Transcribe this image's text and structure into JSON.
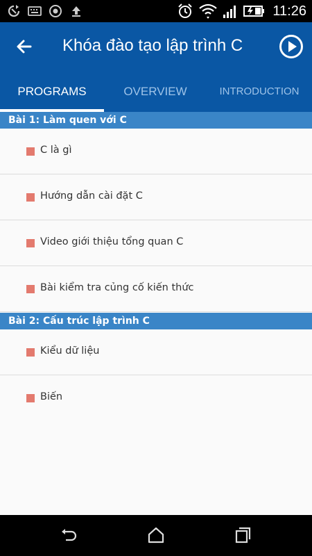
{
  "status_bar": {
    "time": "11:26",
    "icons": [
      "sync-icon",
      "keyboard-icon",
      "circle-icon",
      "upload-icon",
      "alarm-icon",
      "wifi-icon",
      "signal-icon",
      "battery-charging-icon"
    ]
  },
  "app_bar": {
    "title": "Khóa đào tạo lập trình C",
    "back_icon": "arrow-left-icon",
    "play_icon": "play-circle-icon"
  },
  "tabs": [
    {
      "label": "PROGRAMS",
      "active": true
    },
    {
      "label": "OVERVIEW",
      "active": false
    },
    {
      "label": "INTRODUCTION",
      "active": false
    }
  ],
  "sections": [
    {
      "header": "Bài 1: Làm quen với C",
      "items": [
        {
          "label": "C là gì"
        },
        {
          "label": "Hướng dẫn cài đặt C"
        },
        {
          "label": "Video giới thiệu tổng quan C"
        },
        {
          "label": "Bài kiểm tra củng cố kiến thức"
        }
      ]
    },
    {
      "header": "Bài 2: Cấu trúc lập trình C",
      "items": [
        {
          "label": "Kiểu dữ liệu"
        },
        {
          "label": "Biến"
        }
      ]
    }
  ],
  "nav_bar": {
    "icons": [
      "back-icon",
      "home-icon",
      "recents-icon"
    ]
  },
  "colors": {
    "primary": "#0a57a4",
    "section_header": "#3a85c7",
    "bullet": "#e37a6e",
    "tab_inactive": "#9ec3e8"
  }
}
